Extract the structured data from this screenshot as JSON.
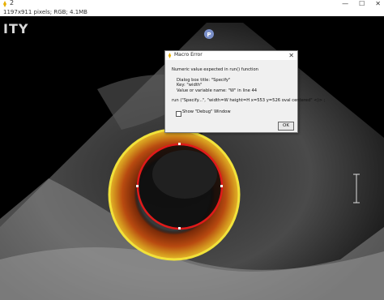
{
  "window": {
    "title": "2",
    "minimize_glyph": "—",
    "maximize_glyph": "☐",
    "close_glyph": "✕",
    "info": "1197x911 pixels; RGB; 4.1MB"
  },
  "image": {
    "corner_label": "ITY",
    "marker_label": "P"
  },
  "dialog": {
    "title": "Macro Error",
    "close_glyph": "✕",
    "lines": [
      "Numeric value expected in run() function",
      "",
      "Dialog box title: \"Specify\"",
      "Key: \"width\"",
      "Value or variable name: \"W\" in line 44",
      "",
      "run (\"Specify...\", \"width=W height=H x=553 y=526 oval centered\" <)> ;"
    ],
    "checkbox_label": "Show \"Debug\" Window",
    "checkbox_checked": false,
    "ok_label": "OK"
  },
  "colors": {
    "outer_ring": "#f1e23a",
    "inner_ring": "#e01a1a",
    "heat_fill": "#b84a10"
  }
}
